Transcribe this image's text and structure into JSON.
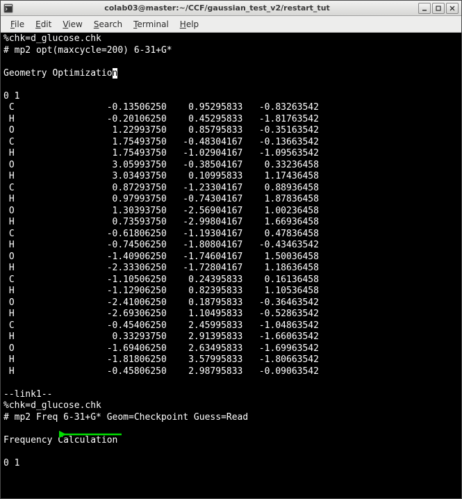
{
  "window": {
    "title": "colab03@master:~/CCF/gaussian_test_v2/restart_tut"
  },
  "menu": {
    "file": "File",
    "edit": "Edit",
    "view": "View",
    "search": "Search",
    "terminal": "Terminal",
    "help": "Help"
  },
  "term": {
    "l1": "%chk=d_glucose.chk",
    "l2": "# mp2 opt(maxcycle=200) 6-31+G*",
    "l3": "",
    "l4a": "Geometry Optimizatio",
    "l4b": "n",
    "l5": "",
    "l6": "0 1",
    "rows": [
      " C                 -0.13506250    0.95295833   -0.83263542",
      " H                 -0.20106250    0.45295833   -1.81763542",
      " O                  1.22993750    0.85795833   -0.35163542",
      " C                  1.75493750   -0.48304167   -0.13663542",
      " H                  1.75493750   -1.02904167   -1.09563542",
      " O                  3.05993750   -0.38504167    0.33236458",
      " H                  3.03493750    0.10995833    1.17436458",
      " C                  0.87293750   -1.23304167    0.88936458",
      " H                  0.97993750   -0.74304167    1.87836458",
      " O                  1.30393750   -2.56904167    1.00236458",
      " H                  0.73593750   -2.99804167    1.66936458",
      " C                 -0.61806250   -1.19304167    0.47836458",
      " H                 -0.74506250   -1.80804167   -0.43463542",
      " O                 -1.40906250   -1.74604167    1.50036458",
      " H                 -2.33306250   -1.72804167    1.18636458",
      " C                 -1.10506250    0.24395833    0.16136458",
      " H                 -1.12906250    0.82395833    1.10536458",
      " O                 -2.41006250    0.18795833   -0.36463542",
      " H                 -2.69306250    1.10495833   -0.52863542",
      " C                 -0.45406250    2.45995833   -1.04863542",
      " H                  0.33293750    2.91395833   -1.66063542",
      " O                 -1.69406250    2.63495833   -1.69963542",
      " H                 -1.81806250    3.57995833   -1.80663542",
      " H                 -0.45806250    2.98795833   -0.09063542"
    ],
    "l_after_rows": "",
    "link": "--link1--",
    "chk2": "%chk=d_glucose.chk",
    "mp2freq": "# mp2 Freq 6-31+G* Geom=Checkpoint Guess=Read",
    "blank2": "",
    "freq": "Frequency Calculation",
    "blank3": "",
    "zeroone": "0 1"
  }
}
